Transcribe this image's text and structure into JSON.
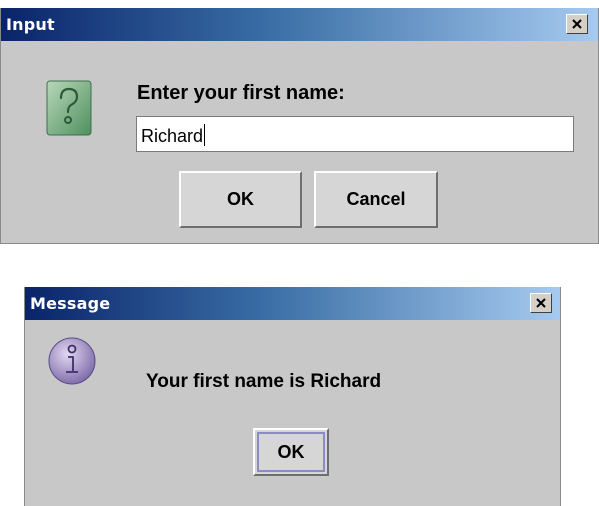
{
  "input_dialog": {
    "title": "Input",
    "prompt": "Enter your first name:",
    "field_value": "Richard",
    "ok_label": "OK",
    "cancel_label": "Cancel",
    "icon": "question-icon"
  },
  "message_dialog": {
    "title": "Message",
    "message": "Your first name is Richard",
    "ok_label": "OK",
    "icon": "information-icon"
  },
  "colors": {
    "titlebar_start": "#0a246a",
    "titlebar_end": "#a6caf0",
    "dialog_bg": "#c8c8c8"
  }
}
